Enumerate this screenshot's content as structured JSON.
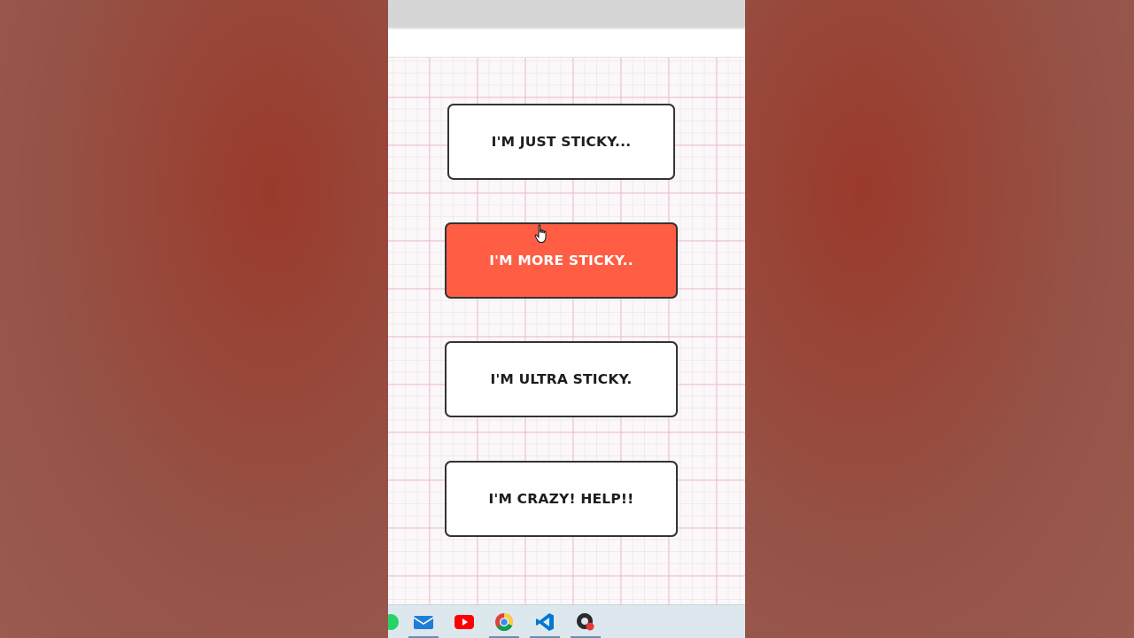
{
  "buttons": {
    "just_sticky": "I'M JUST STICKY...",
    "more_sticky": "I'M MORE STICKY..",
    "ultra_sticky": "I'M ULTRA STICKY.",
    "crazy": "I'M CRAZY! HELP!!"
  },
  "colors": {
    "accent": "#ff5e45",
    "border": "#333333",
    "grid_pink": "#f0b4d7"
  },
  "taskbar": {
    "icons": [
      "whatsapp-icon",
      "mail-icon",
      "youtube-icon",
      "chrome-icon",
      "vscode-icon",
      "obs-icon"
    ]
  }
}
